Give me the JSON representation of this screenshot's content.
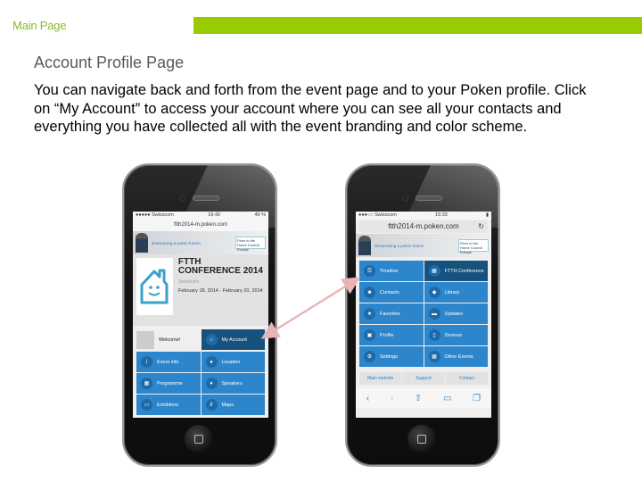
{
  "header": {
    "section_label": "Main Page",
    "accent_color": "#99cc00"
  },
  "content": {
    "heading": "Account Profile Page",
    "body": "You can navigate back and forth from the event page and to your Poken profile. Click on “My Account” to access your account where you can see all your contacts and everything you have collected all with the event branding and color scheme."
  },
  "left_phone": {
    "status": {
      "carrier": "●●●●● Swisscom",
      "time": "16:42",
      "battery": "49 %"
    },
    "url": "ftth2014-m.poken.com",
    "banner": {
      "text": "showcasing a poken future!",
      "logo": "Fibre to the Home Council Europe"
    },
    "conference": {
      "title": "FTTH CONFERENCE 2014",
      "city": "Stockholm",
      "dates": "February 18, 2014 - February 20, 2014"
    },
    "welcome": "Welcome!",
    "tiles": [
      {
        "label": "My Account",
        "icon": "home-icon",
        "dark": true
      },
      {
        "label": "Event info",
        "icon": "info-icon"
      },
      {
        "label": "Location",
        "icon": "location-pin-icon"
      },
      {
        "label": "Programme",
        "icon": "calendar-icon"
      },
      {
        "label": "Speakers",
        "icon": "microphone-icon"
      },
      {
        "label": "Exhibitors",
        "icon": "presentation-icon"
      },
      {
        "label": "Maps",
        "icon": "paperclip-icon"
      }
    ]
  },
  "right_phone": {
    "status": {
      "carrier": "●●●○○ Swisscom",
      "time": "15:33"
    },
    "url": "ftth2014-m.poken.com",
    "banner": {
      "text": "Showcasing a poken future!",
      "logo": "Fibre to the Home Council Europe"
    },
    "tiles": [
      {
        "label": "Timeline",
        "icon": "list-icon"
      },
      {
        "label": "FTTH Conference",
        "icon": "calendar-icon",
        "dark": true
      },
      {
        "label": "Contacts",
        "icon": "contacts-icon"
      },
      {
        "label": "Library",
        "icon": "tag-icon"
      },
      {
        "label": "Favorites",
        "icon": "star-icon"
      },
      {
        "label": "Updates",
        "icon": "briefcase-icon"
      },
      {
        "label": "Profile",
        "icon": "id-card-icon"
      },
      {
        "label": "Devices",
        "icon": "phone-icon"
      },
      {
        "label": "Settings",
        "icon": "gear-icon"
      },
      {
        "label": "Other Events",
        "icon": "calendar-icon"
      }
    ],
    "footer_links": [
      "Main website",
      "Support",
      "Contact"
    ],
    "toolbar": [
      "‹",
      "›",
      "⇧",
      "▭",
      "❐"
    ]
  },
  "annotation": {
    "arrow_color": "#e8b4b8"
  }
}
